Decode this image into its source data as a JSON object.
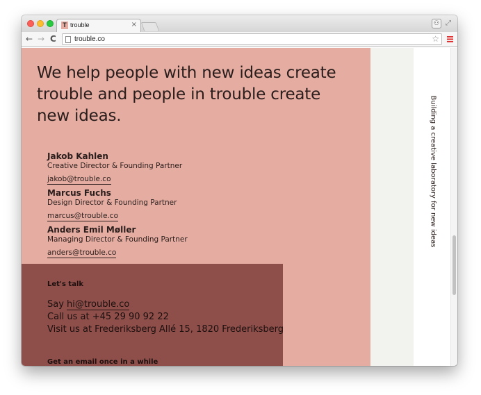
{
  "browser": {
    "tab_title": "trouble",
    "tab_favicon_letter": "T",
    "tab_close": "×",
    "url": "trouble.co",
    "back_icon": "←",
    "forward_icon": "→",
    "reload_icon": "C",
    "star_icon": "☆",
    "profile_icon": "⚇",
    "fullscreen_icon": "⤢",
    "accent": "#d33333"
  },
  "page": {
    "tagline": "We help people with new ideas create trouble and people in trouble create new ideas.",
    "side_text": "Building a creative laboratory for new ideas",
    "colors": {
      "main_pane": "#e5ada2",
      "contact_box": "#8e4f4a",
      "text": "#2a1d1b"
    },
    "people": [
      {
        "name": "Jakob Kahlen",
        "role": "Creative Director & Founding Partner",
        "email": "jakob@trouble.co"
      },
      {
        "name": "Marcus Fuchs",
        "role": "Design Director & Founding Partner",
        "email": "marcus@trouble.co"
      },
      {
        "name": "Anders Emil Møller",
        "role": "Managing Director & Founding Partner",
        "email": "anders@trouble.co"
      }
    ],
    "contact": {
      "heading": "Let's talk",
      "say_prefix": "Say ",
      "say_email": "hi@trouble.co",
      "phone": "Call us at +45 29 90 92 22",
      "address": "Visit us at Frederiksberg Allé 15, 1820 Frederiksberg",
      "newsletter": "Get an email once in a while"
    }
  }
}
